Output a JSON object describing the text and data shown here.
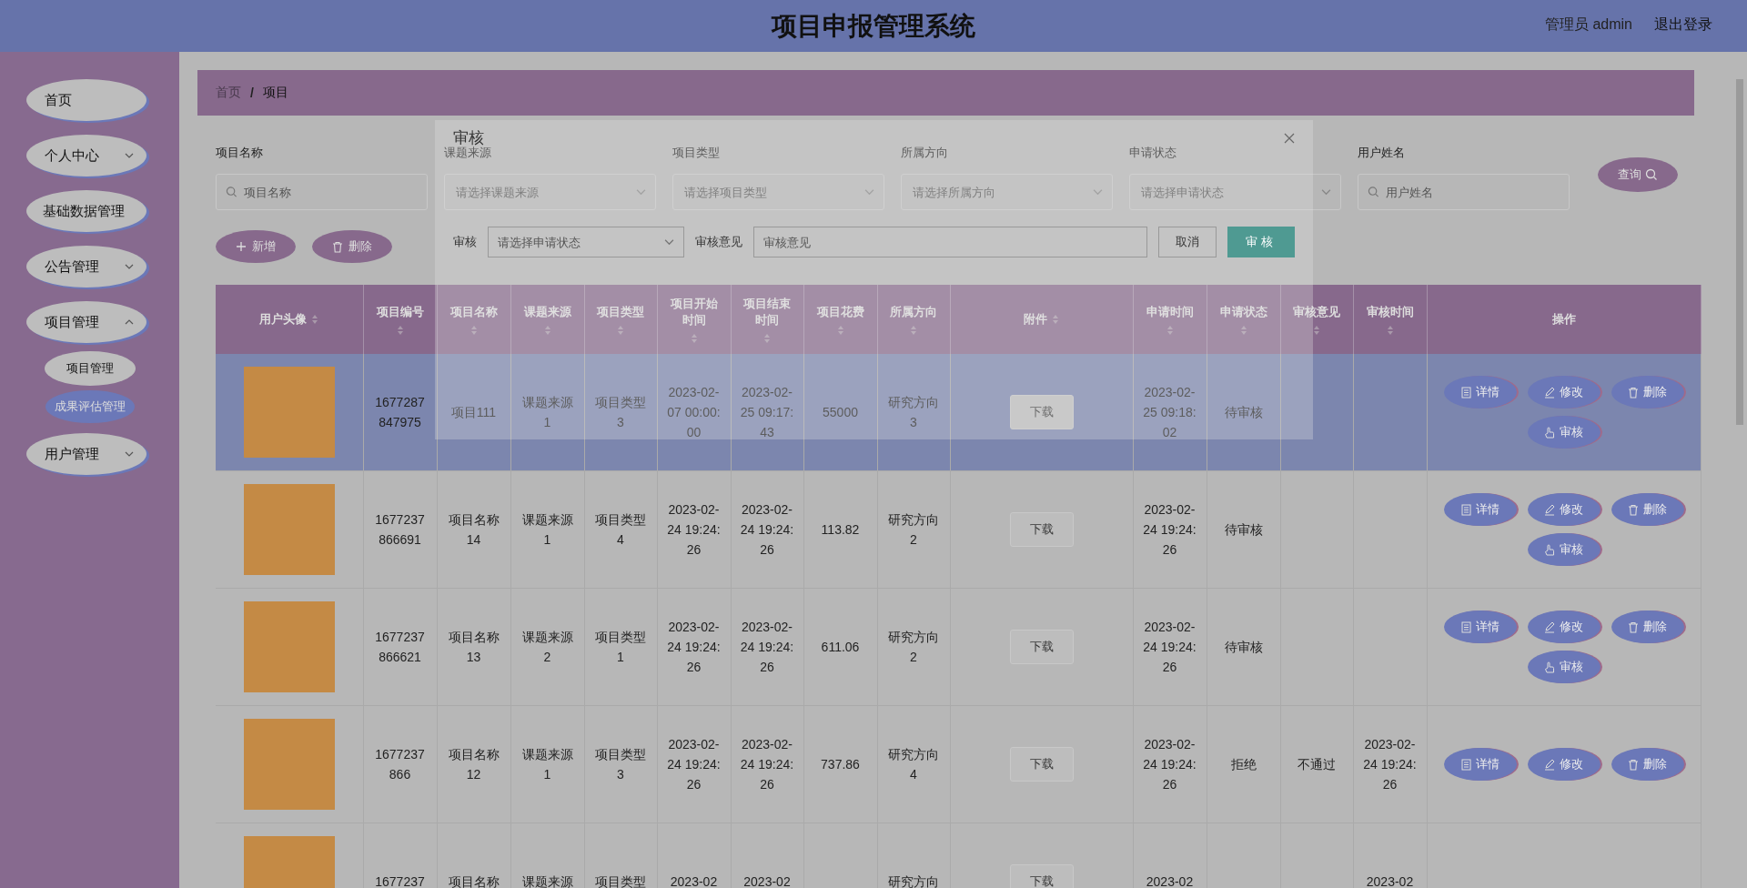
{
  "header": {
    "title": "项目申报管理系统",
    "user": "管理员 admin",
    "logout": "退出登录"
  },
  "sidebar": {
    "items": [
      {
        "label": "首页"
      },
      {
        "label": "个人中心",
        "expanded": false
      },
      {
        "label": "基础数据管理"
      },
      {
        "label": "公告管理",
        "expanded": false
      },
      {
        "label": "项目管理",
        "expanded": true,
        "children": [
          {
            "label": "项目管理",
            "selected": false
          },
          {
            "label": "成果评估管理",
            "selected": true
          }
        ]
      },
      {
        "label": "用户管理",
        "expanded": false
      }
    ]
  },
  "breadcrumb": [
    "首页",
    "项目"
  ],
  "breadcrumb_separator": "/",
  "filters": [
    {
      "label": "项目名称",
      "kind": "search",
      "placeholder": "项目名称"
    },
    {
      "label": "课题来源",
      "kind": "select",
      "placeholder": "请选择课题来源"
    },
    {
      "label": "项目类型",
      "kind": "select",
      "placeholder": "请选择项目类型"
    },
    {
      "label": "所属方向",
      "kind": "select",
      "placeholder": "请选择所属方向"
    },
    {
      "label": "申请状态",
      "kind": "select",
      "placeholder": "请选择申请状态"
    },
    {
      "label": "用户姓名",
      "kind": "search",
      "placeholder": "用户姓名"
    }
  ],
  "query_button": "查询",
  "actions": [
    {
      "label": "新增",
      "kind": "add"
    },
    {
      "label": "删除",
      "kind": "delete"
    }
  ],
  "table": {
    "columns": [
      {
        "label": "用户头像",
        "sortable": true
      },
      {
        "label": "项目编号",
        "sortable": true
      },
      {
        "label": "项目名称",
        "sortable": true
      },
      {
        "label": "课题来源",
        "sortable": true
      },
      {
        "label": "项目类型",
        "sortable": true
      },
      {
        "label": "项目开始时间",
        "sortable": true
      },
      {
        "label": "项目结束时间",
        "sortable": true
      },
      {
        "label": "项目花费",
        "sortable": true
      },
      {
        "label": "所属方向",
        "sortable": true
      },
      {
        "label": "附件",
        "sortable": true
      },
      {
        "label": "申请时间",
        "sortable": true
      },
      {
        "label": "申请状态",
        "sortable": true
      },
      {
        "label": "审核意见",
        "sortable": true
      },
      {
        "label": "审核时间",
        "sortable": true
      },
      {
        "label": "操作",
        "sortable": false
      }
    ],
    "rows": [
      {
        "selected": true,
        "cells": [
          "",
          "1677287847975",
          "项目111",
          "课题来源1",
          "项目类型3",
          "2023-02-07 00:00:00",
          "2023-02-25 09:17:43",
          "55000",
          "研究方向3",
          "下载",
          "2023-02-25 09:18:02",
          "待审核",
          "",
          ""
        ],
        "ops": [
          {
            "label": "详情",
            "kind": "detail"
          },
          {
            "label": "修改",
            "kind": "edit"
          },
          {
            "label": "删除",
            "kind": "delete"
          },
          {
            "label": "审核",
            "kind": "audit"
          }
        ]
      },
      {
        "selected": false,
        "cells": [
          "",
          "1677237866691",
          "项目名称14",
          "课题来源1",
          "项目类型4",
          "2023-02-24 19:24:26",
          "2023-02-24 19:24:26",
          "113.82",
          "研究方向2",
          "下载",
          "2023-02-24 19:24:26",
          "待审核",
          "",
          ""
        ],
        "ops": [
          {
            "label": "详情",
            "kind": "detail"
          },
          {
            "label": "修改",
            "kind": "edit"
          },
          {
            "label": "删除",
            "kind": "delete"
          },
          {
            "label": "审核",
            "kind": "audit"
          }
        ]
      },
      {
        "selected": false,
        "cells": [
          "",
          "1677237866621",
          "项目名称13",
          "课题来源2",
          "项目类型1",
          "2023-02-24 19:24:26",
          "2023-02-24 19:24:26",
          "611.06",
          "研究方向2",
          "下载",
          "2023-02-24 19:24:26",
          "待审核",
          "",
          ""
        ],
        "ops": [
          {
            "label": "详情",
            "kind": "detail"
          },
          {
            "label": "修改",
            "kind": "edit"
          },
          {
            "label": "删除",
            "kind": "delete"
          },
          {
            "label": "审核",
            "kind": "audit"
          }
        ]
      },
      {
        "selected": false,
        "cells": [
          "",
          "1677237866",
          "项目名称12",
          "课题来源1",
          "项目类型3",
          "2023-02-24 19:24:26",
          "2023-02-24 19:24:26",
          "737.86",
          "研究方向4",
          "下载",
          "2023-02-24 19:24:26",
          "拒绝",
          "不通过",
          "2023-02-24 19:24:26"
        ],
        "ops": [
          {
            "label": "详情",
            "kind": "detail"
          },
          {
            "label": "修改",
            "kind": "edit"
          },
          {
            "label": "删除",
            "kind": "delete"
          }
        ]
      },
      {
        "selected": false,
        "cells": [
          "",
          "1677237",
          "项目名称",
          "课题来源",
          "项目类型",
          "2023-02",
          "2023-02",
          "",
          "研究方向",
          "下载",
          "2023-02",
          "",
          "",
          "2023-02"
        ],
        "ops": []
      }
    ]
  },
  "dialog": {
    "title": "审核",
    "field_label": "审核",
    "select_placeholder": "请选择申请状态",
    "comment_label": "审核意见",
    "comment_placeholder": "审核意见",
    "cancel": "取消",
    "confirm": "审核"
  }
}
